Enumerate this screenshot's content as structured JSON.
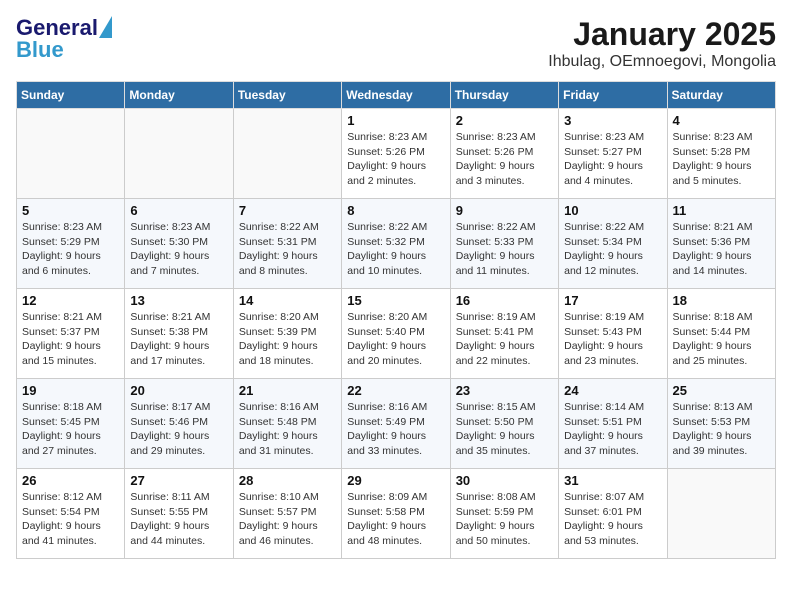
{
  "logo": {
    "line1": "General",
    "line2": "Blue"
  },
  "title": "January 2025",
  "subtitle": "Ihbulag, OEmnoegovi, Mongolia",
  "days_of_week": [
    "Sunday",
    "Monday",
    "Tuesday",
    "Wednesday",
    "Thursday",
    "Friday",
    "Saturday"
  ],
  "weeks": [
    [
      {
        "day": "",
        "sunrise": "",
        "sunset": "",
        "daylight": ""
      },
      {
        "day": "",
        "sunrise": "",
        "sunset": "",
        "daylight": ""
      },
      {
        "day": "",
        "sunrise": "",
        "sunset": "",
        "daylight": ""
      },
      {
        "day": "1",
        "sunrise": "Sunrise: 8:23 AM",
        "sunset": "Sunset: 5:26 PM",
        "daylight": "Daylight: 9 hours and 2 minutes."
      },
      {
        "day": "2",
        "sunrise": "Sunrise: 8:23 AM",
        "sunset": "Sunset: 5:26 PM",
        "daylight": "Daylight: 9 hours and 3 minutes."
      },
      {
        "day": "3",
        "sunrise": "Sunrise: 8:23 AM",
        "sunset": "Sunset: 5:27 PM",
        "daylight": "Daylight: 9 hours and 4 minutes."
      },
      {
        "day": "4",
        "sunrise": "Sunrise: 8:23 AM",
        "sunset": "Sunset: 5:28 PM",
        "daylight": "Daylight: 9 hours and 5 minutes."
      }
    ],
    [
      {
        "day": "5",
        "sunrise": "Sunrise: 8:23 AM",
        "sunset": "Sunset: 5:29 PM",
        "daylight": "Daylight: 9 hours and 6 minutes."
      },
      {
        "day": "6",
        "sunrise": "Sunrise: 8:23 AM",
        "sunset": "Sunset: 5:30 PM",
        "daylight": "Daylight: 9 hours and 7 minutes."
      },
      {
        "day": "7",
        "sunrise": "Sunrise: 8:22 AM",
        "sunset": "Sunset: 5:31 PM",
        "daylight": "Daylight: 9 hours and 8 minutes."
      },
      {
        "day": "8",
        "sunrise": "Sunrise: 8:22 AM",
        "sunset": "Sunset: 5:32 PM",
        "daylight": "Daylight: 9 hours and 10 minutes."
      },
      {
        "day": "9",
        "sunrise": "Sunrise: 8:22 AM",
        "sunset": "Sunset: 5:33 PM",
        "daylight": "Daylight: 9 hours and 11 minutes."
      },
      {
        "day": "10",
        "sunrise": "Sunrise: 8:22 AM",
        "sunset": "Sunset: 5:34 PM",
        "daylight": "Daylight: 9 hours and 12 minutes."
      },
      {
        "day": "11",
        "sunrise": "Sunrise: 8:21 AM",
        "sunset": "Sunset: 5:36 PM",
        "daylight": "Daylight: 9 hours and 14 minutes."
      }
    ],
    [
      {
        "day": "12",
        "sunrise": "Sunrise: 8:21 AM",
        "sunset": "Sunset: 5:37 PM",
        "daylight": "Daylight: 9 hours and 15 minutes."
      },
      {
        "day": "13",
        "sunrise": "Sunrise: 8:21 AM",
        "sunset": "Sunset: 5:38 PM",
        "daylight": "Daylight: 9 hours and 17 minutes."
      },
      {
        "day": "14",
        "sunrise": "Sunrise: 8:20 AM",
        "sunset": "Sunset: 5:39 PM",
        "daylight": "Daylight: 9 hours and 18 minutes."
      },
      {
        "day": "15",
        "sunrise": "Sunrise: 8:20 AM",
        "sunset": "Sunset: 5:40 PM",
        "daylight": "Daylight: 9 hours and 20 minutes."
      },
      {
        "day": "16",
        "sunrise": "Sunrise: 8:19 AM",
        "sunset": "Sunset: 5:41 PM",
        "daylight": "Daylight: 9 hours and 22 minutes."
      },
      {
        "day": "17",
        "sunrise": "Sunrise: 8:19 AM",
        "sunset": "Sunset: 5:43 PM",
        "daylight": "Daylight: 9 hours and 23 minutes."
      },
      {
        "day": "18",
        "sunrise": "Sunrise: 8:18 AM",
        "sunset": "Sunset: 5:44 PM",
        "daylight": "Daylight: 9 hours and 25 minutes."
      }
    ],
    [
      {
        "day": "19",
        "sunrise": "Sunrise: 8:18 AM",
        "sunset": "Sunset: 5:45 PM",
        "daylight": "Daylight: 9 hours and 27 minutes."
      },
      {
        "day": "20",
        "sunrise": "Sunrise: 8:17 AM",
        "sunset": "Sunset: 5:46 PM",
        "daylight": "Daylight: 9 hours and 29 minutes."
      },
      {
        "day": "21",
        "sunrise": "Sunrise: 8:16 AM",
        "sunset": "Sunset: 5:48 PM",
        "daylight": "Daylight: 9 hours and 31 minutes."
      },
      {
        "day": "22",
        "sunrise": "Sunrise: 8:16 AM",
        "sunset": "Sunset: 5:49 PM",
        "daylight": "Daylight: 9 hours and 33 minutes."
      },
      {
        "day": "23",
        "sunrise": "Sunrise: 8:15 AM",
        "sunset": "Sunset: 5:50 PM",
        "daylight": "Daylight: 9 hours and 35 minutes."
      },
      {
        "day": "24",
        "sunrise": "Sunrise: 8:14 AM",
        "sunset": "Sunset: 5:51 PM",
        "daylight": "Daylight: 9 hours and 37 minutes."
      },
      {
        "day": "25",
        "sunrise": "Sunrise: 8:13 AM",
        "sunset": "Sunset: 5:53 PM",
        "daylight": "Daylight: 9 hours and 39 minutes."
      }
    ],
    [
      {
        "day": "26",
        "sunrise": "Sunrise: 8:12 AM",
        "sunset": "Sunset: 5:54 PM",
        "daylight": "Daylight: 9 hours and 41 minutes."
      },
      {
        "day": "27",
        "sunrise": "Sunrise: 8:11 AM",
        "sunset": "Sunset: 5:55 PM",
        "daylight": "Daylight: 9 hours and 44 minutes."
      },
      {
        "day": "28",
        "sunrise": "Sunrise: 8:10 AM",
        "sunset": "Sunset: 5:57 PM",
        "daylight": "Daylight: 9 hours and 46 minutes."
      },
      {
        "day": "29",
        "sunrise": "Sunrise: 8:09 AM",
        "sunset": "Sunset: 5:58 PM",
        "daylight": "Daylight: 9 hours and 48 minutes."
      },
      {
        "day": "30",
        "sunrise": "Sunrise: 8:08 AM",
        "sunset": "Sunset: 5:59 PM",
        "daylight": "Daylight: 9 hours and 50 minutes."
      },
      {
        "day": "31",
        "sunrise": "Sunrise: 8:07 AM",
        "sunset": "Sunset: 6:01 PM",
        "daylight": "Daylight: 9 hours and 53 minutes."
      },
      {
        "day": "",
        "sunrise": "",
        "sunset": "",
        "daylight": ""
      }
    ]
  ]
}
